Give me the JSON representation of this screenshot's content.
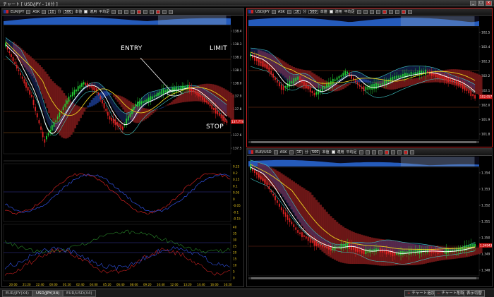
{
  "window": {
    "title": "チャート [ USD/JPY - 10分 ]"
  },
  "panels": [
    {
      "id": "main",
      "pair": "EUR/JPY",
      "side": "ASK",
      "period": "10",
      "count": "500",
      "mode1": "本値",
      "mode2": "適用",
      "mode3": "平均足",
      "y_ticks": [
        "138.4",
        "138.3",
        "138.2",
        "138.1",
        "138.0",
        "137.9",
        "137.8",
        "137.7",
        "137.6",
        "137.5"
      ],
      "price_tag": "137.774",
      "x_ticks": [
        "20:00",
        "21:20",
        "22:40",
        "00:00",
        "01:20",
        "02:40",
        "04:00",
        "05:20",
        "06:40",
        "08:00",
        "09:20",
        "10:40",
        "12:00",
        "13:20",
        "14:40",
        "16:00",
        "16:20"
      ],
      "osc1_ticks": [
        "0.25",
        "0.2",
        "0.15",
        "0.1",
        "0.05",
        "0",
        "-0.05",
        "-0.1",
        "-0.15"
      ],
      "osc2_ticks": [
        "40",
        "35",
        "30",
        "25",
        "20",
        "15",
        "10",
        "5",
        "0"
      ]
    },
    {
      "id": "usdjpy",
      "pair": "USD/JPY",
      "side": "ASK",
      "period": "10",
      "count": "500",
      "mode1": "本値",
      "mode2": "適用",
      "mode3": "平均足",
      "y_ticks": [
        "102.5",
        "102.4",
        "102.3",
        "102.2",
        "102.1",
        "102.0",
        "101.9",
        "101.8"
      ],
      "price_tag": "102.057"
    },
    {
      "id": "eurusd",
      "pair": "EUR/USD",
      "side": "ASK",
      "period": "10",
      "count": "500",
      "mode1": "本値",
      "mode2": "適用",
      "mode3": "平均足",
      "y_ticks": [
        "1.354",
        "1.353",
        "1.352",
        "1.351",
        "1.350",
        "1.349",
        "1.348"
      ],
      "price_tag": "1.34943"
    }
  ],
  "annotations": {
    "entry": "ENTRY",
    "limit": "LIMIT",
    "stop": "STOP"
  },
  "tabs": [
    {
      "label": "EUR/JPY(X4)",
      "active": false
    },
    {
      "label": "USD/JPY(X4)",
      "active": true
    },
    {
      "label": "EUR/USD(X4)",
      "active": false
    }
  ],
  "bottom_buttons": {
    "add_chart": "チャート追加",
    "delete_chart": "チャート削除",
    "display_switch": "表示切替"
  },
  "colors": {
    "up": "#22cc33",
    "down": "#dd2222",
    "cloud_bear": "#7a1a1a",
    "cloud_bull": "#1a3a8a",
    "ma_fast": "#ffffff",
    "ma_slow": "#e8d020",
    "band": "#40c8c8",
    "overview": "#2a6ad8"
  }
}
